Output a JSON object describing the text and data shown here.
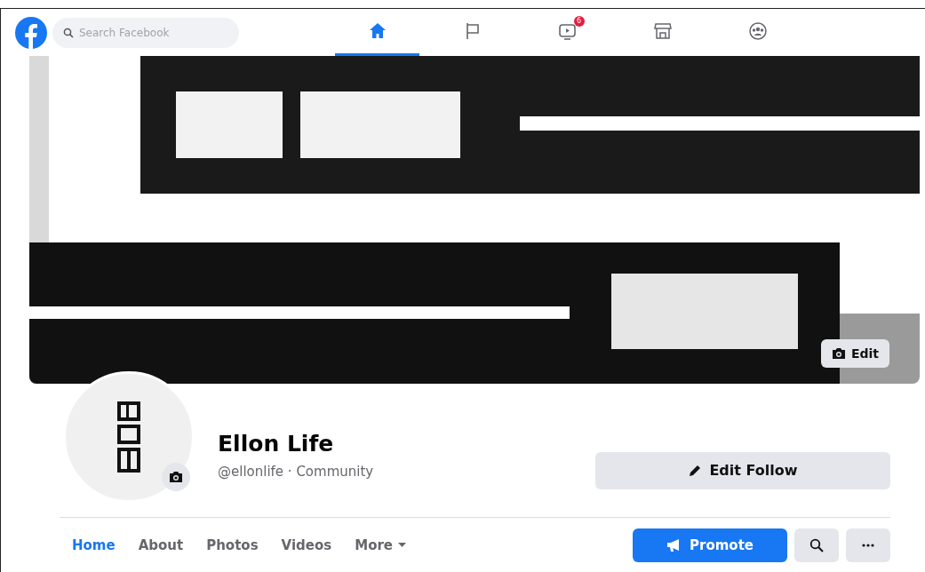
{
  "header": {
    "search": {
      "placeholder": "Search Facebook"
    },
    "nav": [
      {
        "kind": "home",
        "selected": true
      },
      {
        "kind": "flag",
        "selected": false
      },
      {
        "kind": "video",
        "selected": false,
        "badge": "6"
      },
      {
        "kind": "store",
        "selected": false
      },
      {
        "kind": "groups",
        "selected": false
      }
    ]
  },
  "cover": {
    "edit_button": "Edit"
  },
  "profile": {
    "name": "Ellon Life",
    "subtitle": "@ellonlife · Community",
    "action_button": "Edit Follow"
  },
  "tabs": [
    {
      "label": "Home",
      "selected": true
    },
    {
      "label": "About",
      "selected": false
    },
    {
      "label": "Photos",
      "selected": false
    },
    {
      "label": "Videos",
      "selected": false
    },
    {
      "label": "More",
      "selected": false,
      "dropdown": true
    }
  ],
  "actions": {
    "promote": "Promote"
  }
}
